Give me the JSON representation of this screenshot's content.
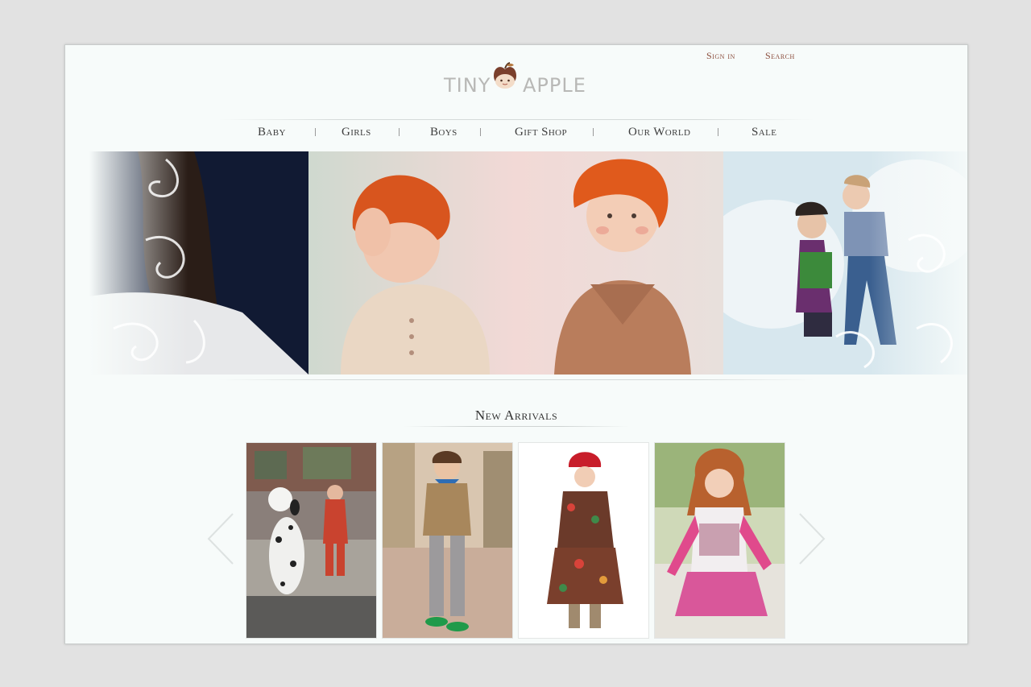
{
  "header": {
    "sign_in": "Sign in",
    "search": "Search",
    "logo_left": "TINY",
    "logo_right": "APPLE",
    "logo_icon": "apple-face-icon"
  },
  "nav": {
    "items": [
      "Baby",
      "Girls",
      "Boys",
      "Gift Shop",
      "Our World",
      "Sale"
    ]
  },
  "new_arrivals": {
    "title": "New Arrivals",
    "prev_icon": "chevron-left-icon",
    "next_icon": "chevron-right-icon"
  },
  "colors": {
    "accent": "#8a4b3a",
    "background": "#f7fbfa",
    "page": "#e2e2e2",
    "nav_text": "#3d3d3d"
  }
}
